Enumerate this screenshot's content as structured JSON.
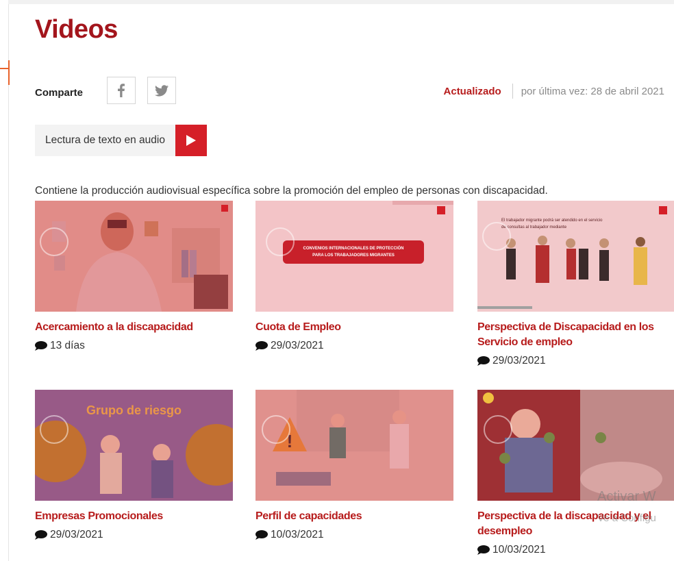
{
  "page": {
    "title": "Videos"
  },
  "share": {
    "label": "Comparte",
    "icons": [
      "facebook-icon",
      "twitter-icon"
    ]
  },
  "updated": {
    "label": "Actualizado",
    "date": "por última vez: 28 de abril 2021"
  },
  "audio": {
    "label": "Lectura de texto en audio"
  },
  "description": "Contiene la producción audiovisual específica sobre la promoción del empleo de personas con discapacidad.",
  "colors": {
    "accent": "#b71c1c",
    "play": "#d51f28",
    "overlay": "#d8343c"
  },
  "videos": [
    {
      "title": "Acercamiento a la discapacidad",
      "date": "13 días"
    },
    {
      "title": "Cuota de Empleo",
      "date": "29/03/2021",
      "thumb_text": [
        "CONVENIOS INTERNACIONALES DE PROTECCIÓN",
        "PARA LOS TRABAJADORES MIGRANTES"
      ]
    },
    {
      "title": "Perspectiva de Discapacidad en los Servicio de empleo",
      "date": "29/03/2021",
      "thumb_text": [
        "El trabajador migrante podrá ser atendido en el servicio",
        "de consultas al trabajador mediante"
      ]
    },
    {
      "title": "Empresas Promocionales",
      "date": "29/03/2021",
      "thumb_text": [
        "Grupo de riesgo"
      ]
    },
    {
      "title": "Perfil de capacidades",
      "date": "10/03/2021"
    },
    {
      "title": "Perspectiva de la discapacidad y el desempleo",
      "date": "10/03/2021"
    }
  ],
  "watermark": {
    "line1": "Activar W",
    "line2": "Ve a Configu"
  }
}
